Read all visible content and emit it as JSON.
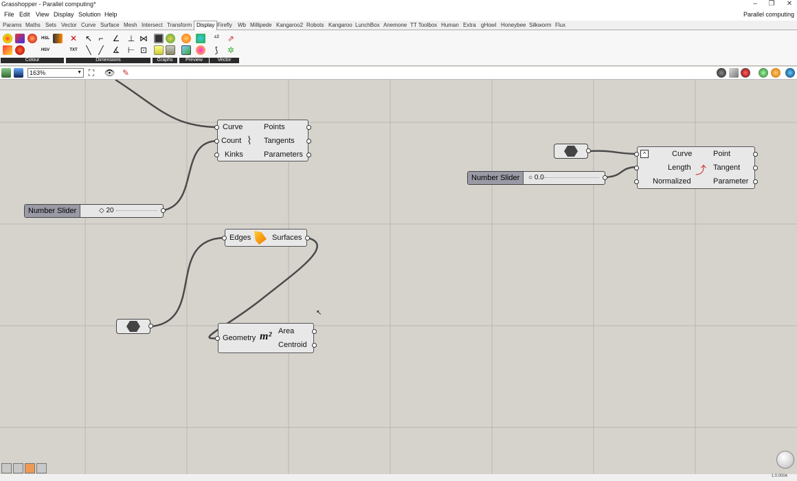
{
  "window": {
    "title": "Grasshopper - Parallel computing*",
    "document_label": "Parallel computing"
  },
  "menu": [
    "File",
    "Edit",
    "View",
    "Display",
    "Solution",
    "Help"
  ],
  "tabs": [
    "Params",
    "Maths",
    "Sets",
    "Vector",
    "Curve",
    "Surface",
    "Mesh",
    "Intersect",
    "Transform",
    "Display",
    "Firefly",
    "Wb",
    "Millipede",
    "Kangaroo2",
    "Robots",
    "Kangaroo",
    "LunchBox",
    "Anemone",
    "TT Toolbox",
    "Human",
    "Extra",
    "gHowl",
    "Honeybee",
    "Silkworm",
    "Flux"
  ],
  "active_tab": "Display",
  "ribbon_panels": [
    "Colour",
    "Dimensions",
    "Graphs",
    "Preview",
    "Vector"
  ],
  "canvas_toolbar": {
    "zoom": "163%"
  },
  "components": {
    "divide_curve": {
      "inputs": [
        "Curve",
        "Count",
        "Kinks"
      ],
      "outputs": [
        "Points",
        "Tangents",
        "Parameters"
      ]
    },
    "boundary_surfaces": {
      "inputs": [
        "Edges"
      ],
      "outputs": [
        "Surfaces"
      ]
    },
    "area": {
      "inputs": [
        "Geometry"
      ],
      "outputs": [
        "Area",
        "Centroid"
      ],
      "icon_text": "m²"
    },
    "eval_length": {
      "inputs": [
        "Curve",
        "Length",
        "Normalized"
      ],
      "outputs": [
        "Point",
        "Tangent",
        "Parameter"
      ]
    }
  },
  "sliders": {
    "count_slider": {
      "name": "Number Slider",
      "value": "20"
    },
    "length_slider": {
      "name": "Number Slider",
      "value": "0.0"
    }
  },
  "status": {
    "version": "1.0.0004"
  },
  "colors": {
    "canvas": "#d6d3cd",
    "grid": "#b9b6b0",
    "wire": "#4a4a4a",
    "component": "#e8e8e8",
    "slider_name": "#9a9aa6"
  }
}
